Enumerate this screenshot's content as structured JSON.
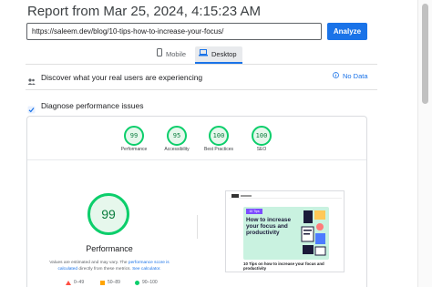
{
  "header": {
    "title": "Report from Mar 25, 2024, 4:15:23 AM"
  },
  "search": {
    "url_value": "https://saleem.dev/blog/10-tips-how-to-increase-your-focus/",
    "analyze_label": "Analyze"
  },
  "tabs": [
    {
      "label": "Mobile",
      "icon": "phone-icon"
    },
    {
      "label": "Desktop",
      "icon": "laptop-icon",
      "selected": true
    }
  ],
  "sections": {
    "real_users": {
      "label": "Discover what your real users are experiencing",
      "status": "No Data"
    },
    "diagnose": {
      "label": "Diagnose performance issues"
    }
  },
  "scores": [
    {
      "label": "Performance",
      "value": "99"
    },
    {
      "label": "Accessibility",
      "value": "95"
    },
    {
      "label": "Best Practices",
      "value": "100"
    },
    {
      "label": "SEO",
      "value": "100"
    }
  ],
  "main_score": {
    "value": "99",
    "title": "Performance",
    "note_prefix": "Values are estimated and may vary. The ",
    "note_link1": "performance score is calculated",
    "note_mid": " directly from these metrics. ",
    "note_link2": "See calculator."
  },
  "legend": [
    {
      "label": "0–49"
    },
    {
      "label": "50–89"
    },
    {
      "label": "90–100"
    }
  ],
  "thumbnail": {
    "badge": "10 Tips",
    "headline": "How to increase your focus and productivity",
    "caption": "10 Tips on how to increase your focus and productivity"
  },
  "colors": {
    "accent": "#1a73e8",
    "pass": "#0cce6b",
    "average": "#ffa400",
    "fail": "#ff4e42"
  }
}
